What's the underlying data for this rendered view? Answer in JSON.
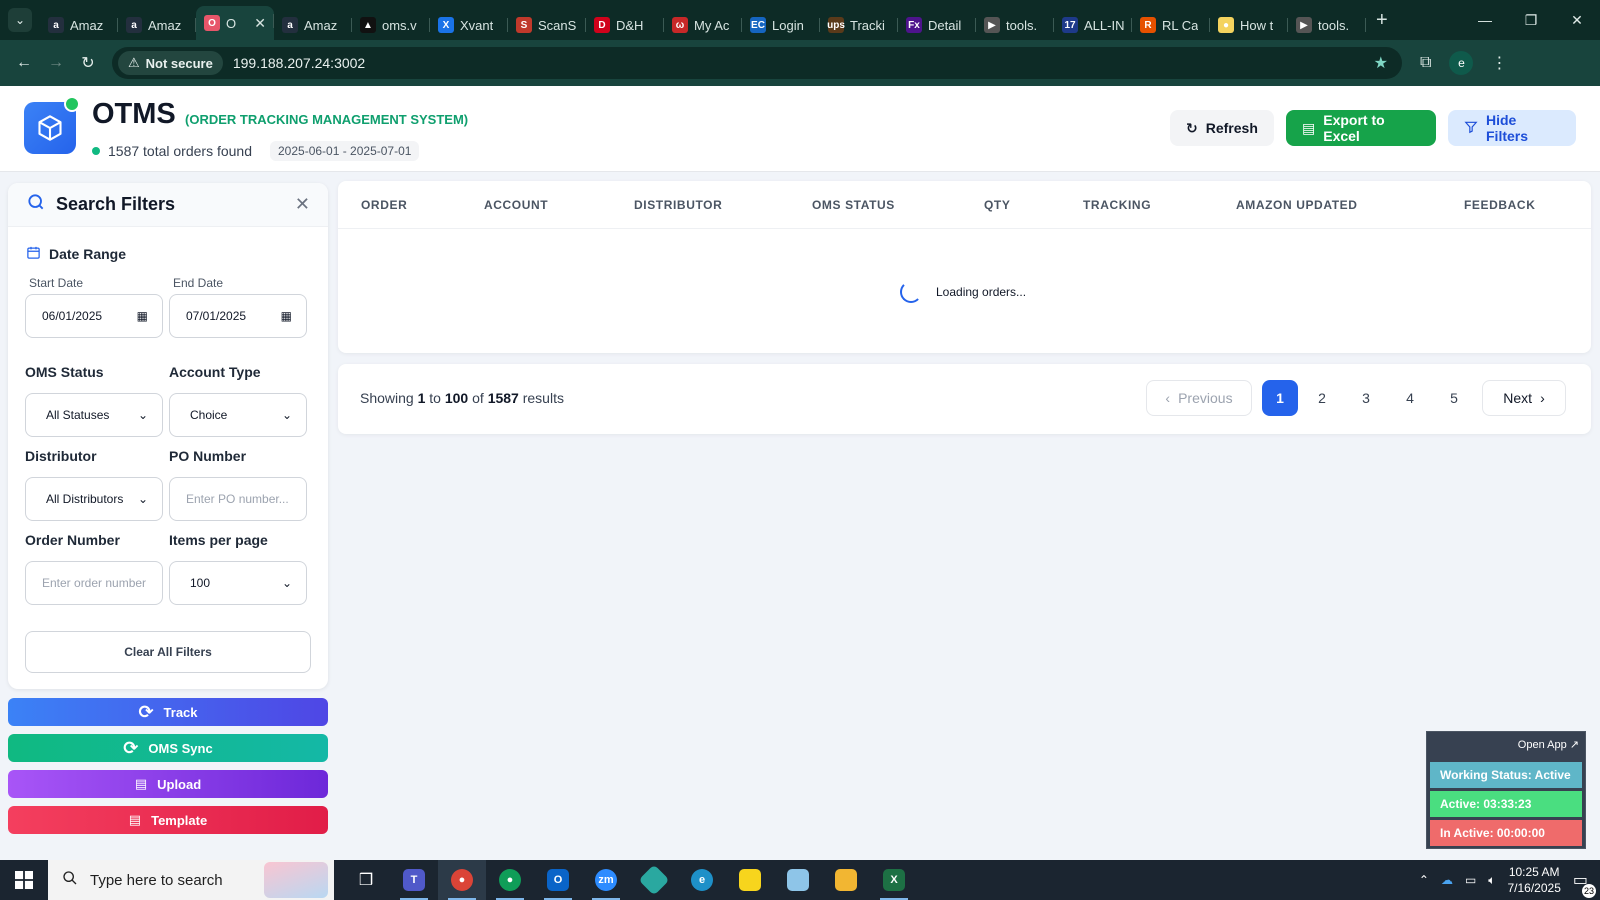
{
  "browser": {
    "tabs": [
      {
        "title": "Amaz",
        "fav": "a",
        "color": "#232f3e"
      },
      {
        "title": "Amaz",
        "fav": "a",
        "color": "#232f3e"
      },
      {
        "title": "O",
        "fav": "O",
        "color": "#e7566a",
        "active": true
      },
      {
        "title": "Amaz",
        "fav": "a",
        "color": "#232f3e"
      },
      {
        "title": "oms.v",
        "fav": "▲",
        "color": "#111111"
      },
      {
        "title": "Xvant",
        "fav": "X",
        "color": "#1a73e8"
      },
      {
        "title": "ScanS",
        "fav": "S",
        "color": "#c0392b"
      },
      {
        "title": "D&H",
        "fav": "D",
        "color": "#d0021b"
      },
      {
        "title": "My Ac",
        "fav": "ω",
        "color": "#c62828"
      },
      {
        "title": "Login",
        "fav": "EC",
        "color": "#1565c0"
      },
      {
        "title": "Tracki",
        "fav": "ups",
        "color": "#5a3a1a"
      },
      {
        "title": "Detail",
        "fav": "Fx",
        "color": "#4d148c"
      },
      {
        "title": "tools.",
        "fav": "▶",
        "color": "#555555"
      },
      {
        "title": "ALL-IN",
        "fav": "17",
        "color": "#1e3a8a"
      },
      {
        "title": "RL Ca",
        "fav": "R",
        "color": "#e65100"
      },
      {
        "title": "How t",
        "fav": "●",
        "color": "#f4d35e"
      },
      {
        "title": "tools.",
        "fav": "▶",
        "color": "#555555"
      }
    ],
    "not_secure_label": "Not secure",
    "url": "199.188.207.24:3002",
    "profile_initial": "e"
  },
  "header": {
    "title": "OTMS",
    "subtitle": "(ORDER TRACKING MANAGEMENT SYSTEM)",
    "count_text": "1587 total orders found",
    "date_range": "2025-06-01 - 2025-07-01",
    "refresh_label": "Refresh",
    "export_label": "Export to Excel",
    "hide_filters_label": "Hide Filters"
  },
  "filters": {
    "title": "Search Filters",
    "date_range_label": "Date Range",
    "start_date_label": "Start Date",
    "start_date_value": "06/01/2025",
    "end_date_label": "End Date",
    "end_date_value": "07/01/2025",
    "oms_status_label": "OMS Status",
    "oms_status_value": "All Statuses",
    "account_type_label": "Account Type",
    "account_type_value": "Choice",
    "distributor_label": "Distributor",
    "distributor_value": "All Distributors",
    "po_number_label": "PO Number",
    "po_number_placeholder": "Enter PO number...",
    "order_number_label": "Order Number",
    "order_number_placeholder": "Enter order number",
    "items_per_page_label": "Items per page",
    "items_per_page_value": "100",
    "clear_label": "Clear All Filters"
  },
  "actions": {
    "track": "Track",
    "oms_sync": "OMS Sync",
    "upload": "Upload",
    "template": "Template"
  },
  "table": {
    "columns": [
      "ORDER",
      "ACCOUNT",
      "DISTRIBUTOR",
      "OMS STATUS",
      "QTY",
      "TRACKING",
      "AMAZON UPDATED",
      "FEEDBACK"
    ],
    "loading_text": "Loading orders..."
  },
  "pagination": {
    "showing_prefix": "Showing",
    "from": "1",
    "to_word": "to",
    "to": "100",
    "of_word": "of",
    "total": "1587",
    "results_word": "results",
    "previous_label": "Previous",
    "next_label": "Next",
    "pages": [
      "1",
      "2",
      "3",
      "4",
      "5"
    ],
    "current_page": "1"
  },
  "widget": {
    "open_app": "Open App ↗",
    "working_status": "Working Status: Active",
    "active": "Active: 03:33:23",
    "inactive": "In Active: 00:00:00"
  },
  "taskbar": {
    "search_placeholder": "Type here to search",
    "time": "10:25 AM",
    "date": "7/16/2025",
    "notifications": "23"
  }
}
